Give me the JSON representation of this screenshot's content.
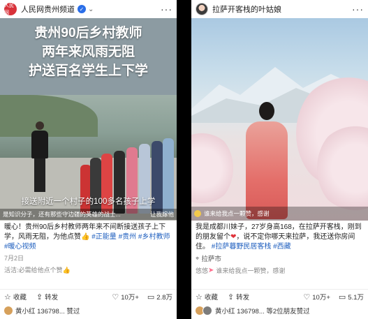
{
  "left": {
    "channel": "人民网贵州频道",
    "logo_text": "人民网",
    "video_title_lines": [
      "贵州90后乡村教师",
      "两年来风雨无阻",
      "护送百名学生上下学"
    ],
    "subtitle": "接送附近一个村子的100多名孩子上学",
    "subtitle2_left": "是知识分子，还有那些守边疆的英雄的战士...",
    "subtitle2_right": "让我嫁他",
    "caption_prefix": "暖心！贵州90后乡村教师两年来不间断接送孩子上下学，风雨无阻，为他点赞",
    "caption_tags": "#正能量 #贵州 #乡村教师 #暖心视频",
    "date": "7月2日",
    "comment_user": "活洁:",
    "comment_text": "必需给他点个赞👍",
    "actions": {
      "fav": "收藏",
      "share": "转发",
      "likes": "10万+",
      "comments": "2.8万"
    },
    "liked_by": "黄小红 136798... 赞过"
  },
  "right": {
    "channel": "拉萨开客栈的叶姑娘",
    "caption_prefix": "我是成都川妹子，27岁身高168，在拉萨开客栈，刚到的朋友留个",
    "caption_mid": "，说不定你哪天来拉萨，我还送你房间住。",
    "caption_tags": "#拉萨暮野民居客栈 #西藏",
    "location": "拉萨市",
    "video_bar_text": "谁来给我点一颗赞，感谢",
    "video_bar_right": "",
    "comment_user": "悠悠",
    "comment_text": "谁来给我点一颗赞，感谢",
    "actions": {
      "fav": "收藏",
      "share": "转发",
      "likes": "10万+",
      "comments": "5.1万"
    },
    "liked_by": "黄小红 136798... 等2位朋友赞过"
  },
  "icons": {
    "verified": "verified-icon",
    "more": "more-dots-icon",
    "location": "location-pin-icon"
  }
}
